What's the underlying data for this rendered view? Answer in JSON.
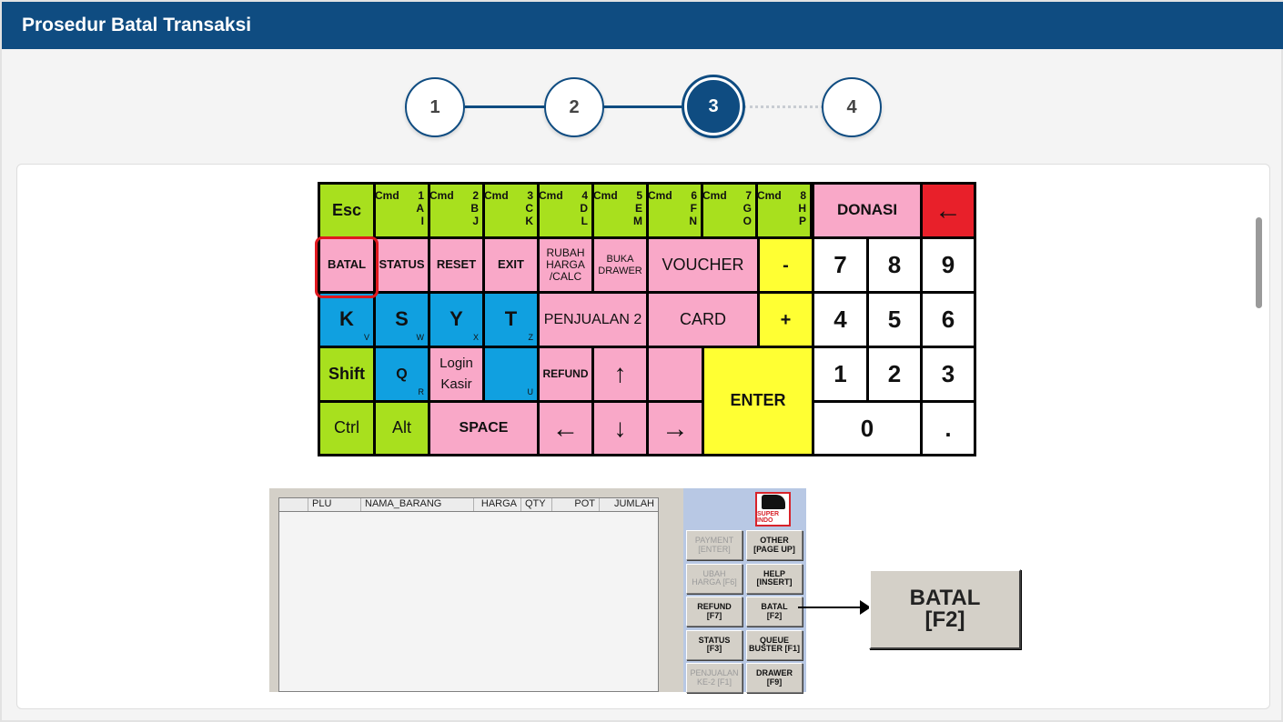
{
  "header": {
    "title": "Prosedur Batal Transaksi"
  },
  "stepper": {
    "steps": [
      "1",
      "2",
      "3",
      "4"
    ],
    "active_step": 3
  },
  "keyboard": {
    "row1": {
      "esc": "Esc",
      "cmds": [
        {
          "top": "Cmd",
          "num": "1",
          "l1": "A",
          "l2": "I"
        },
        {
          "top": "Cmd",
          "num": "2",
          "l1": "B",
          "l2": "J"
        },
        {
          "top": "Cmd",
          "num": "3",
          "l1": "C",
          "l2": "K"
        },
        {
          "top": "Cmd",
          "num": "4",
          "l1": "D",
          "l2": "L"
        },
        {
          "top": "Cmd",
          "num": "5",
          "l1": "E",
          "l2": "M"
        },
        {
          "top": "Cmd",
          "num": "6",
          "l1": "F",
          "l2": "N"
        },
        {
          "top": "Cmd",
          "num": "7",
          "l1": "G",
          "l2": "O"
        },
        {
          "top": "Cmd",
          "num": "8",
          "l1": "H",
          "l2": "P"
        }
      ],
      "donasi": "DONASI",
      "backspace": "←"
    },
    "row2": {
      "batal": "BATAL",
      "status": "STATUS",
      "reset": "RESET",
      "exit": "EXIT",
      "rubah": "RUBAH HARGA /CALC",
      "buka": "BUKA DRAWER",
      "voucher": "VOUCHER",
      "minus": "-",
      "n7": "7",
      "n8": "8",
      "n9": "9"
    },
    "row3": {
      "k": "K",
      "k_sub": "V",
      "s": "S",
      "s_sub": "W",
      "y": "Y",
      "y_sub": "X",
      "t": "T",
      "t_sub": "Z",
      "penjualan2": "PENJUALAN 2",
      "card": "CARD",
      "plus": "+",
      "n4": "4",
      "n5": "5",
      "n6": "6"
    },
    "row4": {
      "shift": "Shift",
      "q": "Q",
      "q_sub": "R",
      "login": "Login Kasir",
      "u_sub": "U",
      "refund": "REFUND",
      "up": "↑",
      "enter": "ENTER",
      "n1": "1",
      "n2": "2",
      "n3": "3"
    },
    "row5": {
      "ctrl": "Ctrl",
      "alt": "Alt",
      "space": "SPACE",
      "left": "←",
      "down": "↓",
      "right": "→",
      "n0": "0",
      "dot": "."
    }
  },
  "pos": {
    "columns": [
      "",
      "PLU",
      "NAMA_BARANG",
      "HARGA",
      "QTY",
      "POT",
      "JUMLAH"
    ],
    "logo_text": "SUPER INDO",
    "buttons": [
      {
        "l1": "PAYMENT",
        "l2": "[ENTER]",
        "disabled": true
      },
      {
        "l1": "OTHER",
        "l2": "[PAGE UP]",
        "disabled": false
      },
      {
        "l1": "UBAH",
        "l2": "HARGA [F6]",
        "disabled": true
      },
      {
        "l1": "HELP",
        "l2": "[INSERT]",
        "disabled": false
      },
      {
        "l1": "REFUND",
        "l2": "[F7]",
        "disabled": false
      },
      {
        "l1": "BATAL",
        "l2": "[F2]",
        "disabled": false
      },
      {
        "l1": "STATUS",
        "l2": "[F3]",
        "disabled": false
      },
      {
        "l1": "QUEUE",
        "l2": "BUSTER [F1]",
        "disabled": false
      },
      {
        "l1": "PENJUALAN",
        "l2": "KE-2 [F1]",
        "disabled": true
      },
      {
        "l1": "DRAWER",
        "l2": "[F9]",
        "disabled": false
      }
    ],
    "zoom_button": {
      "l1": "BATAL",
      "l2": "[F2]"
    }
  }
}
